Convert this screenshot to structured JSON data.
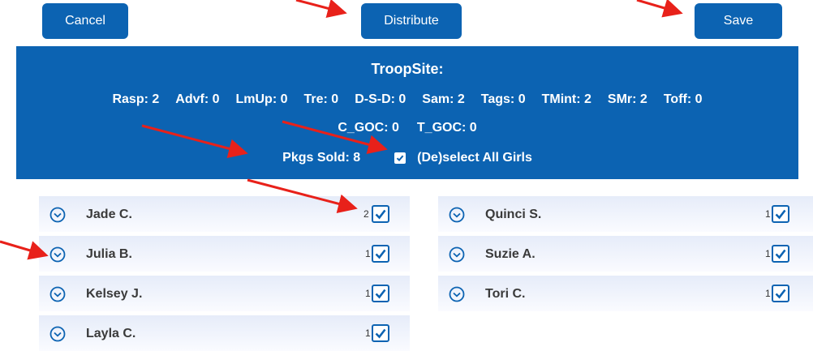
{
  "buttons": {
    "cancel": "Cancel",
    "distribute": "Distribute",
    "save": "Save"
  },
  "summary": {
    "title": "TroopSite:",
    "counts": [
      "Rasp: 2",
      "Advf: 0",
      "LmUp: 0",
      "Tre: 0",
      "D-S-D: 0",
      "Sam: 2",
      "Tags: 0",
      "TMint: 2",
      "SMr: 2",
      "Toff: 0"
    ],
    "counts2": [
      "C_GOC: 0",
      "T_GOC: 0"
    ],
    "pkgs_sold": "Pkgs Sold: 8",
    "select_all_label": "(De)select All Girls",
    "select_all_checked": true
  },
  "girls_left": [
    {
      "name": "Jade C.",
      "qty": "2",
      "checked": true
    },
    {
      "name": "Julia B.",
      "qty": "1",
      "checked": true
    },
    {
      "name": "Kelsey J.",
      "qty": "1",
      "checked": true
    },
    {
      "name": "Layla C.",
      "qty": "1",
      "checked": true
    }
  ],
  "girls_right": [
    {
      "name": "Quinci S.",
      "qty": "1",
      "checked": true
    },
    {
      "name": "Suzie A.",
      "qty": "1",
      "checked": true
    },
    {
      "name": "Tori C.",
      "qty": "1",
      "checked": true
    }
  ],
  "colors": {
    "primary": "#0c63b2",
    "row_gradient_top": "#e6ecf9",
    "annotation_arrow": "#e8211a"
  }
}
